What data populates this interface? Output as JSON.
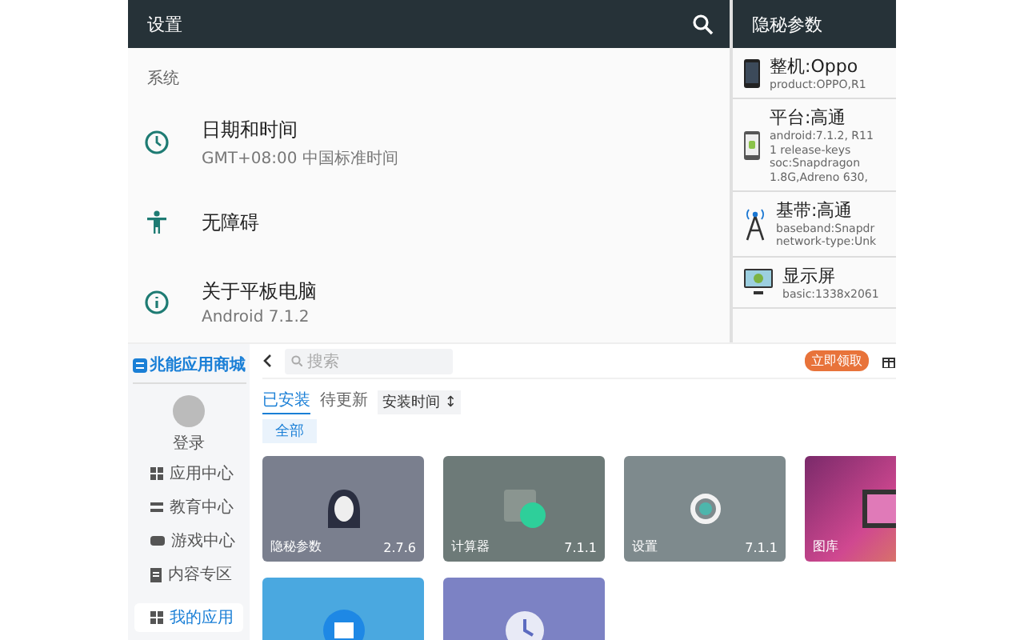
{
  "settings": {
    "title": "设置",
    "section": "系统",
    "items": [
      {
        "kind": "clock",
        "title": "日期和时间",
        "subtitle": "GMT+08:00 中国标准时间"
      },
      {
        "kind": "accessibility",
        "title": "无障碍"
      },
      {
        "kind": "info",
        "title": "关于平板电脑",
        "subtitle": "Android 7.1.2"
      }
    ]
  },
  "hidden_params": {
    "title": "隐秘参数",
    "items": [
      {
        "kind": "phone",
        "title": "整机:Oppo",
        "lines": [
          "product:OPPO,R1"
        ]
      },
      {
        "kind": "android",
        "title": "平台:高通",
        "lines": [
          "android:7.1.2, R11",
          "1 release-keys",
          "soc:Snapdragon",
          "1.8G,Adreno 630,"
        ]
      },
      {
        "kind": "antenna",
        "title": "基带:高通",
        "lines": [
          "baseband:Snapdr",
          "network-type:Unk"
        ]
      },
      {
        "kind": "monitor",
        "title": "显示屏",
        "lines": [
          "basic:1338x2061"
        ]
      }
    ]
  },
  "store": {
    "logo": "兆能应用商城",
    "login": "登录",
    "nav": [
      {
        "kind": "grid",
        "label": "应用中心",
        "selected": false
      },
      {
        "kind": "book",
        "label": "教育中心",
        "selected": false
      },
      {
        "kind": "gamepad",
        "label": "游戏中心",
        "selected": false
      },
      {
        "kind": "doc",
        "label": "内容专区",
        "selected": false
      },
      {
        "kind": "grid",
        "label": "我的应用",
        "selected": true
      }
    ],
    "search": {
      "placeholder": "搜索"
    },
    "promo": "立即领取",
    "tabs": [
      {
        "label": "已安装",
        "selected": true
      },
      {
        "label": "待更新",
        "selected": false
      }
    ],
    "sort": "安装时间 ↕",
    "filter": "全部",
    "apps": [
      {
        "kind": "mask",
        "name": "隐秘参数",
        "version": "2.7.6"
      },
      {
        "kind": "calc",
        "name": "计算器",
        "version": "7.1.1"
      },
      {
        "kind": "gear",
        "name": "设置",
        "version": "7.1.1"
      },
      {
        "kind": "gallery",
        "name": "图库"
      },
      {
        "kind": "folder"
      },
      {
        "kind": "clock"
      }
    ]
  }
}
